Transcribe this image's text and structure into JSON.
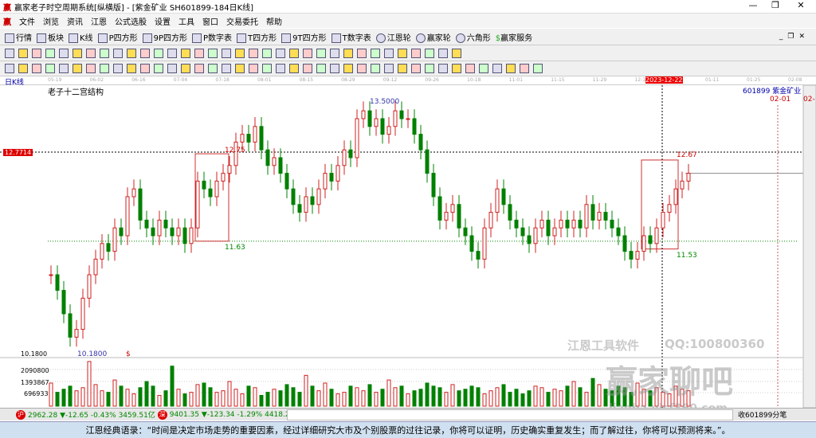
{
  "window": {
    "title": "赢家老子时空周期系统[纵横版] - [紫金矿业  SH601899-184日K线]",
    "controls": [
      "—",
      "❐",
      "✕"
    ]
  },
  "menu": [
    "文件",
    "浏览",
    "资讯",
    "江恩",
    "公式选股",
    "设置",
    "工具",
    "窗口",
    "交易委托",
    "帮助"
  ],
  "toolbar1": [
    "行情",
    "板块",
    "K线",
    "P四方形",
    "9P四方形",
    "P数字表",
    "T四方形",
    "9T四方形",
    "T数字表",
    "江恩轮",
    "赢家轮",
    "六角形",
    "赢家服务"
  ],
  "toolbar1_right": [
    "_",
    "❐",
    "✕"
  ],
  "period": "日K线",
  "chart_title": "老子十二宫结构",
  "dates": [
    "05-19",
    "06-02",
    "06-16",
    "07-04",
    "07-18",
    "08-01",
    "08-15",
    "08-29",
    "09-12",
    "09-26",
    "10-18",
    "11-01",
    "11-15",
    "11-29",
    "12-13",
    "2023-12-22",
    "01-11",
    "01-25",
    "02-08"
  ],
  "stock": "601899 紫金矿业",
  "future_dates": [
    "02-01",
    "02-"
  ],
  "price_labels": {
    "current": "12.7714",
    "low_axis": "10.1800",
    "low": "10.1800",
    "high": "13.5000",
    "box1_top": "12.75",
    "box1_bottom": "11.63",
    "box2_top": "12.67",
    "box2_bottom": "11.53",
    "dollar": "$"
  },
  "volume_labels": [
    "2090800",
    "1393867",
    "696933"
  ],
  "chart_data": {
    "type": "candlestick",
    "ylim": [
      10.0,
      13.9
    ],
    "closes": [
      11.2,
      11.0,
      10.7,
      10.4,
      10.5,
      10.9,
      11.2,
      11.4,
      11.6,
      11.5,
      11.8,
      11.7,
      12.2,
      12.3,
      11.9,
      11.8,
      11.7,
      11.9,
      11.8,
      11.7,
      11.8,
      11.6,
      11.8,
      12.4,
      12.3,
      12.2,
      12.4,
      12.5,
      12.6,
      12.9,
      13.0,
      12.9,
      13.1,
      12.8,
      12.6,
      12.7,
      12.5,
      12.3,
      12.1,
      12.0,
      12.2,
      12.1,
      12.3,
      12.5,
      12.4,
      12.6,
      12.8,
      12.7,
      13.2,
      13.3,
      13.1,
      13.2,
      13.0,
      13.1,
      13.3,
      13.2,
      13.2,
      13.0,
      12.8,
      12.5,
      12.2,
      11.9,
      12.0,
      12.1,
      11.8,
      11.7,
      11.5,
      11.4,
      11.8,
      12.0,
      12.3,
      12.1,
      11.9,
      11.8,
      11.7,
      11.6,
      11.8,
      11.9,
      11.7,
      11.8,
      11.9,
      11.8,
      11.9,
      11.8,
      12.1,
      11.9,
      12.0,
      11.9,
      11.8,
      11.7,
      11.5,
      11.4,
      11.5,
      11.7,
      11.6,
      11.8,
      12.0,
      12.1,
      12.3,
      12.4,
      12.5
    ],
    "volumes": [
      1500,
      900,
      1100,
      1300,
      1000,
      1200,
      2900,
      1400,
      1000,
      900,
      1700,
      1300,
      1100,
      800,
      1200,
      1600,
      1300,
      700,
      1000,
      2600,
      1100,
      800,
      900,
      1400,
      1500,
      1200,
      900,
      1000,
      1600,
      1100,
      800,
      1300,
      1200,
      700,
      900,
      1100,
      1000,
      1400,
      1200,
      900,
      2000,
      1300,
      1000,
      1500,
      1100,
      800,
      900,
      1300,
      1200,
      1000,
      1400,
      900,
      1100,
      1700,
      1200,
      1300,
      800,
      1000,
      1100,
      1500,
      1300,
      1200,
      900,
      1400,
      1000,
      1100,
      1300,
      1200,
      800,
      1000,
      1200,
      1400,
      900,
      1100,
      800,
      1000,
      1300,
      1200,
      900,
      1100,
      1000,
      1300,
      1600,
      1200,
      900,
      1800,
      1400,
      1100,
      1000,
      1300,
      1200,
      900,
      1500,
      1100,
      1000,
      1200,
      900,
      800,
      1300,
      1100,
      1000
    ]
  },
  "watermark": {
    "company": "江恩工具软件",
    "qq": "QQ:100800360",
    "forum": "赢家聊吧",
    "url": "liaoba.yjcf360.com"
  },
  "status": {
    "index1": "2962.28 ▼-12.65 -0.43% 3459.51亿",
    "index2": "9401.35 ▼-123.34 -1.29% 4418.26",
    "right": "收601899分笔"
  },
  "banner": "江恩经典语录：“时间是决定市场走势的重要因素，经过详细研究大市及个别股票的过往记录，你将可以证明，历史确实重复发生；而了解过往，你将可以预测将来。”。",
  "colors": {
    "up": "#d02020",
    "down": "#008000",
    "box": "#d03030",
    "accent": "#e00000"
  }
}
